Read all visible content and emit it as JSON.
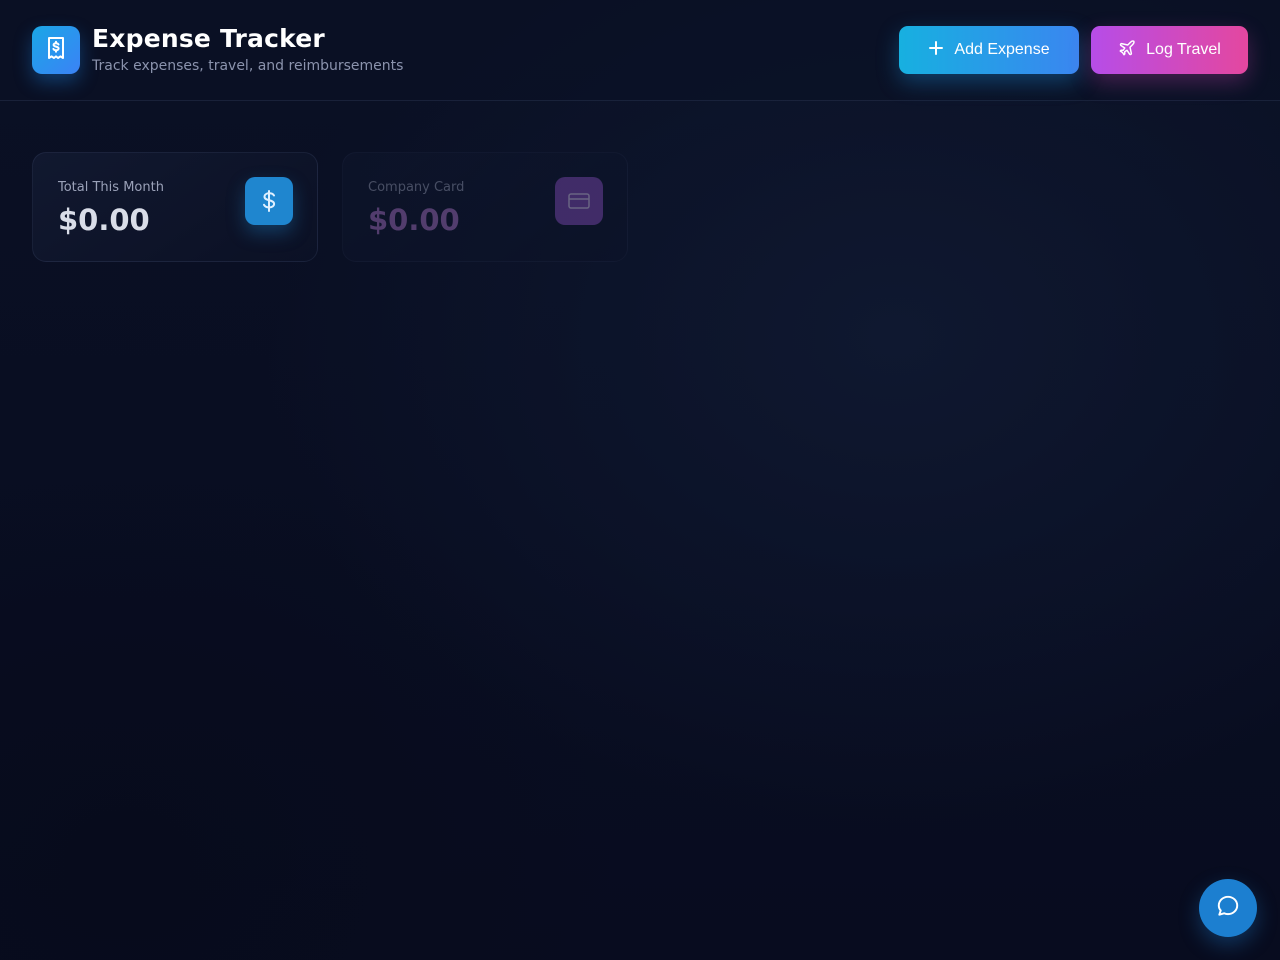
{
  "header": {
    "title": "Expense Tracker",
    "subtitle": "Track expenses, travel, and reimbursements",
    "logo_icon": "receipt-dollar-icon",
    "actions": {
      "add_expense_label": "Add Expense",
      "add_expense_icon": "plus-icon",
      "add_expense_color": "#17b0e0",
      "log_travel_label": "Log Travel",
      "log_travel_icon": "plane-icon",
      "log_travel_color": "#b64de8"
    }
  },
  "stats": [
    {
      "label": "Total This Month",
      "value": "$0.00",
      "icon": "dollar-icon",
      "accent": "#1f86cf"
    },
    {
      "label": "Company Card",
      "value": "$0.00",
      "icon": "credit-card-icon",
      "accent": "#8a4fc0"
    }
  ],
  "chat": {
    "icon": "chat-bubble-icon",
    "accent": "#1c7fd0"
  }
}
